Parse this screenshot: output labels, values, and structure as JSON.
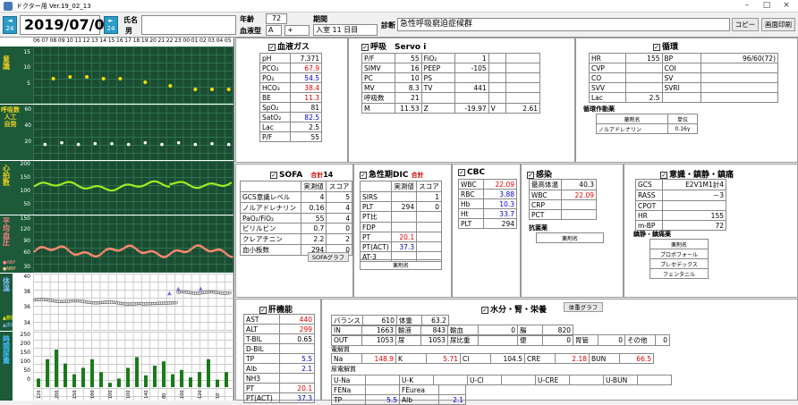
{
  "window": {
    "title": "ドクター用 Ver.19_02_13"
  },
  "header": {
    "prev_btn": "◄\n24",
    "next_btn": "►\n24",
    "date": "2019/07/09",
    "name_label": "氏名",
    "sex": "男",
    "age_label": "年齢",
    "age": "72",
    "blood_label": "血液型",
    "blood_type": "A",
    "rh": "+",
    "period_label": "期間",
    "period": "入室 11 日目",
    "diagnosis_label": "診断",
    "diagnosis": "急性呼吸窮迫症候群",
    "copy_btn": "コピー",
    "print_btn": "画面印刷"
  },
  "timeline": {
    "hours": [
      "06",
      "07",
      "08",
      "09",
      "10",
      "11",
      "12",
      "13",
      "14",
      "15",
      "16",
      "17",
      "18",
      "19",
      "20",
      "21",
      "22",
      "23",
      "00",
      "01",
      "02",
      "03",
      "04",
      "05"
    ]
  },
  "charts": {
    "consciousness": {
      "label": "意識",
      "ticks": [
        "15",
        "10",
        "5"
      ],
      "points": [
        [
          2,
          7
        ],
        [
          4,
          7.5
        ],
        [
          6,
          7.5
        ],
        [
          8,
          7
        ],
        [
          10,
          7
        ],
        [
          13,
          6
        ],
        [
          16,
          5
        ],
        [
          19,
          4
        ],
        [
          21,
          4
        ],
        [
          23,
          4
        ]
      ]
    },
    "resp": {
      "label": "呼吸数（人工・自発）",
      "ticks": [
        "60",
        "40",
        "20"
      ],
      "points": [
        [
          1,
          18
        ],
        [
          3,
          20
        ],
        [
          5,
          18
        ],
        [
          7,
          19
        ],
        [
          9,
          19
        ],
        [
          11,
          18
        ],
        [
          13,
          20
        ],
        [
          15,
          18
        ],
        [
          17,
          20
        ],
        [
          19,
          18
        ],
        [
          21,
          19
        ],
        [
          23,
          18
        ]
      ]
    },
    "hr": {
      "label": "心拍数",
      "ticks": [
        "200",
        "150",
        "100",
        "50"
      ],
      "min": 0,
      "max": 200
    },
    "bp": {
      "label": "平均血圧",
      "legend_a": "ABP",
      "legend_n": "NBP",
      "ticks": [
        "150",
        "120",
        "90",
        "60",
        "30"
      ]
    },
    "temp": {
      "label": "体温",
      "legend_a": "膀胱",
      "legend_b": "皮膚",
      "ticks": [
        "40",
        "38",
        "36",
        "34"
      ]
    },
    "urine": {
      "label": "時間尿量",
      "ticks": [
        "250",
        "200",
        "150",
        "100",
        "50",
        "0"
      ],
      "x_labels": [
        "120",
        "200",
        "150",
        "100",
        "100",
        "100",
        "140",
        "80",
        "100",
        "120",
        "10"
      ],
      "values": [
        40,
        130,
        175,
        110,
        60,
        90,
        130,
        70,
        20,
        40,
        90,
        140,
        55,
        100,
        120,
        60,
        80,
        45,
        70,
        130,
        35,
        70
      ]
    }
  },
  "bloodgas": {
    "title": "血液ガス",
    "rows": [
      {
        "k": "pH",
        "v": "7.371",
        "c": ""
      },
      {
        "k": "PCO₂",
        "v": "67.9",
        "c": "red"
      },
      {
        "k": "PO₂",
        "v": "54.5",
        "c": "blue"
      },
      {
        "k": "HCO₃",
        "v": "38.4",
        "c": "red"
      },
      {
        "k": "BE",
        "v": "11.3",
        "c": "red"
      },
      {
        "k": "SpO₂",
        "v": "81",
        "c": ""
      },
      {
        "k": "SatO₂",
        "v": "82.5",
        "c": "blue"
      },
      {
        "k": "Lac",
        "v": "2.5",
        "c": ""
      },
      {
        "k": "P/F",
        "v": "55",
        "c": ""
      }
    ]
  },
  "resp": {
    "title": "呼吸",
    "device": "Servo i",
    "rows": [
      [
        "P/F",
        "55",
        "FiO₂",
        "1",
        "",
        ""
      ],
      [
        "SIMV",
        "16",
        "PEEP",
        "-105",
        "",
        ""
      ],
      [
        "PC",
        "10",
        "PS",
        "",
        "",
        ""
      ],
      [
        "MV",
        "8.3",
        "TV",
        "441",
        "",
        ""
      ],
      [
        "呼吸数",
        "21",
        "",
        "",
        "",
        ""
      ],
      [
        "M",
        "11.53",
        "Z",
        "-19.97",
        "V",
        "2.61"
      ]
    ]
  },
  "circ": {
    "title": "循環",
    "rows": [
      [
        "HR",
        "155",
        "BP",
        "96/60(72)"
      ],
      [
        "CVP",
        "",
        "COI",
        ""
      ],
      [
        "CO",
        "",
        "SV",
        ""
      ],
      [
        "SVV",
        "",
        "SVRI",
        ""
      ],
      [
        "Lac",
        "2.5",
        "",
        ""
      ]
    ],
    "drug_label": "循環作動薬",
    "drug_head": [
      "薬剤名",
      "単位"
    ],
    "drugs": [
      [
        "ノルアドレナリン",
        "0.16γ"
      ]
    ]
  },
  "sofa": {
    "title": "SOFA",
    "total_label": "合計",
    "total": "14",
    "head": [
      "",
      "実測値",
      "スコア"
    ],
    "rows": [
      [
        "GCS意識レベル",
        "4",
        "5"
      ],
      [
        "ノルアドレナリン",
        "0.16",
        "4"
      ],
      [
        "PaO₂/FiO₂",
        "55",
        "4"
      ],
      [
        "ビリルビン",
        "0.7",
        "0"
      ],
      [
        "クレアチニン",
        "2.2",
        "2"
      ],
      [
        "血小板数",
        "294",
        "0"
      ]
    ],
    "graph_btn": "SOFAグラフ"
  },
  "dic": {
    "title": "急性期DIC",
    "total_label": "合計",
    "head": [
      "",
      "実測値",
      "スコア"
    ],
    "rows": [
      [
        "SIRS",
        "",
        "1"
      ],
      [
        "PLT",
        "294",
        "0"
      ],
      [
        "PT比",
        "",
        ""
      ],
      [
        "FDP",
        "",
        ""
      ],
      [
        "PT",
        "20.1",
        ""
      ],
      [
        "PT(ACT)",
        "37.3",
        ""
      ],
      [
        "AT-3",
        "",
        ""
      ]
    ],
    "drug_head": "薬剤名"
  },
  "cbc": {
    "title": "CBC",
    "rows": [
      [
        "WBC",
        "22.09",
        "red"
      ],
      [
        "RBC",
        "3.88",
        "blue"
      ],
      [
        "Hb",
        "10.3",
        "blue"
      ],
      [
        "Ht",
        "33.7",
        "blue"
      ],
      [
        "PLT",
        "294",
        ""
      ]
    ]
  },
  "infect": {
    "title": "感染",
    "rows": [
      [
        "最高体温",
        "40.3",
        ""
      ],
      [
        "WBC",
        "22.09",
        "red"
      ],
      [
        "CRP",
        "",
        ""
      ],
      [
        "PCT",
        "",
        ""
      ]
    ],
    "drug_label": "抗菌薬",
    "drug_head": "薬剤名"
  },
  "neuro": {
    "title": "意識・鎮静・鎮痛",
    "rows": [
      [
        "GCS",
        "E2V1M1計4"
      ],
      [
        "RASS",
        "－3"
      ],
      [
        "CPOT",
        ""
      ],
      [
        "HR",
        "155"
      ],
      [
        "m-BP",
        "72"
      ]
    ],
    "drug_label": "鎮静・鎮痛薬",
    "drug_head": "薬剤名",
    "drugs": [
      "プロポフォール",
      "プレセデックス",
      "フェンタニル"
    ]
  },
  "liver": {
    "title": "肝機能",
    "rows": [
      [
        "AST",
        "440",
        "red"
      ],
      [
        "ALT",
        "299",
        "red"
      ],
      [
        "T-BIL",
        "0.65",
        ""
      ],
      [
        "D-BIL",
        "",
        ""
      ],
      [
        "TP",
        "5.5",
        "blue"
      ],
      [
        "Alb",
        "2.1",
        "blue"
      ],
      [
        "NH3",
        "",
        ""
      ],
      [
        "PT",
        "20.1",
        "red"
      ],
      [
        "PT(ACT)",
        "37.3",
        "blue"
      ]
    ]
  },
  "fluid": {
    "title": "水分・腎・栄養",
    "graph_btn": "体重グラフ",
    "r1": [
      [
        "バランス",
        "610"
      ],
      [
        "体重",
        "63.2"
      ]
    ],
    "r2": [
      [
        "IN",
        "1663"
      ],
      [
        "輸液",
        "843"
      ],
      [
        "輸血",
        "0"
      ],
      [
        "腸",
        "820"
      ]
    ],
    "r3": [
      [
        "OUT",
        "1053"
      ],
      [
        "尿",
        "1053"
      ],
      [
        "尿比重",
        ""
      ],
      [
        "便",
        "0"
      ],
      [
        "胃管",
        "0"
      ],
      [
        "その他",
        "0"
      ]
    ],
    "elec_label": "電解質",
    "elec": [
      [
        "Na",
        "148.9",
        "red"
      ],
      [
        "K",
        "5.71",
        "red"
      ],
      [
        "Cl",
        "104.5",
        ""
      ],
      [
        "CRE",
        "2.18",
        "red"
      ],
      [
        "BUN",
        "66.5",
        "red"
      ]
    ],
    "urine_elec_label": "尿電解質",
    "uelec": [
      "U-Na",
      "U-K",
      "U-Cl",
      "U-CRE",
      "U-BUN"
    ],
    "r_last": [
      "FENa",
      "FEurea"
    ],
    "r_tp": [
      "TP",
      "5.5",
      "Alb",
      "2.1"
    ]
  }
}
